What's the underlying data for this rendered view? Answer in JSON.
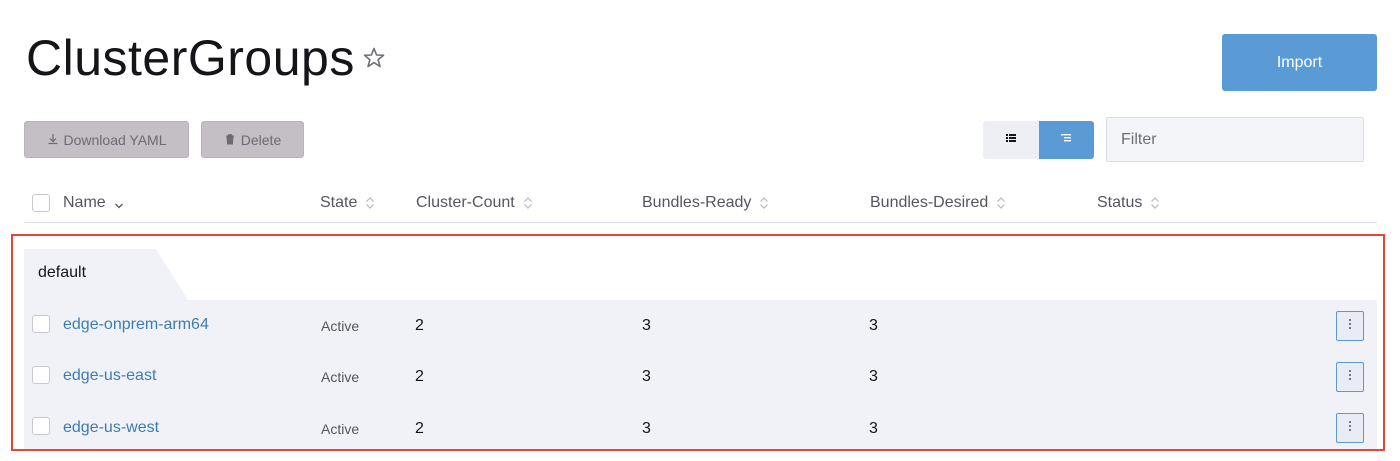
{
  "header": {
    "title": "ClusterGroups",
    "import_label": "Import"
  },
  "bulk_actions": {
    "download_label": "Download YAML",
    "delete_label": "Delete"
  },
  "filter": {
    "placeholder": "Filter"
  },
  "columns": [
    "Name",
    "State",
    "Cluster-Count",
    "Bundles-Ready",
    "Bundles-Desired",
    "Status"
  ],
  "group": {
    "label": "default"
  },
  "rows": [
    {
      "name": "edge-onprem-arm64",
      "state": "Active",
      "cluster_count": "2",
      "bundles_ready": "3",
      "bundles_desired": "3"
    },
    {
      "name": "edge-us-east",
      "state": "Active",
      "cluster_count": "2",
      "bundles_ready": "3",
      "bundles_desired": "3"
    },
    {
      "name": "edge-us-west",
      "state": "Active",
      "cluster_count": "2",
      "bundles_ready": "3",
      "bundles_desired": "3"
    }
  ],
  "colors": {
    "accent": "#5a9ad5",
    "link": "#3d7cb3",
    "highlight_border": "#e0483a"
  }
}
